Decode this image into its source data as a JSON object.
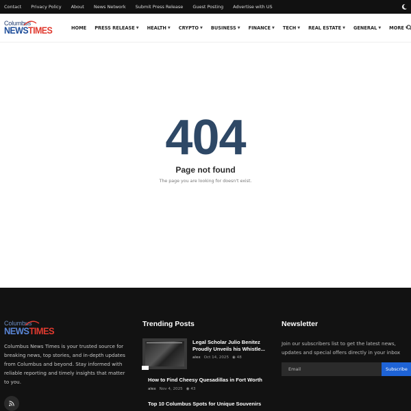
{
  "topbar": {
    "links": [
      "Contact",
      "Privacy Policy",
      "About",
      "News Network",
      "Submit Press Release",
      "Guest Posting",
      "Advertise with US"
    ],
    "theme_toggle_icon": "moon-icon"
  },
  "logo": {
    "line1": "Columbus",
    "line2_main": "NEWS",
    "line2_accent": "TIMES"
  },
  "nav": {
    "items": [
      {
        "label": "HOME",
        "has_dropdown": false
      },
      {
        "label": "PRESS RELEASE",
        "has_dropdown": true
      },
      {
        "label": "HEALTH",
        "has_dropdown": true
      },
      {
        "label": "CRYPTO",
        "has_dropdown": true
      },
      {
        "label": "BUSINESS",
        "has_dropdown": true
      },
      {
        "label": "FINANCE",
        "has_dropdown": true
      },
      {
        "label": "TECH",
        "has_dropdown": true
      },
      {
        "label": "REAL ESTATE",
        "has_dropdown": true
      },
      {
        "label": "GENERAL",
        "has_dropdown": true
      },
      {
        "label": "MORE",
        "has_dropdown": true
      }
    ],
    "search_icon": "search-icon"
  },
  "not_found": {
    "code": "404",
    "title": "Page not found",
    "message": "The page you are looking for doesn't exist."
  },
  "footer": {
    "description": "Columbus News Times is your trusted source for breaking news, top stories, and in-depth updates from Columbus and beyond. Stay informed with reliable reporting and timely insights that matter to you.",
    "rss_icon": "rss-icon",
    "trending": {
      "heading": "Trending Posts",
      "posts": [
        {
          "title": "Legal Scholar Julio Benitez Proudly Unveils his Whistle...",
          "author": "alex",
          "date": "Oct 14, 2025",
          "views": "48"
        },
        {
          "title": "How to Find Cheesy Quesadillas in Fort Worth",
          "author": "alex",
          "date": "Nov 4, 2025",
          "views": "43"
        },
        {
          "title": "Top 10 Columbus Spots for Unique Souvenirs",
          "author": "",
          "date": "",
          "views": ""
        }
      ]
    },
    "newsletter": {
      "heading": "Newsletter",
      "text": "Join our subscribers list to get the latest news, updates and special offers directly in your inbox",
      "email_placeholder": "Email",
      "button_label": "Subscribe"
    }
  },
  "colors": {
    "topbar_bg": "#111111",
    "footer_bg": "#121212",
    "brand_blue": "#1f4e9a",
    "brand_red": "#e03a2f",
    "code_color": "#2e4866",
    "subscribe_bg": "#1e63d6"
  }
}
